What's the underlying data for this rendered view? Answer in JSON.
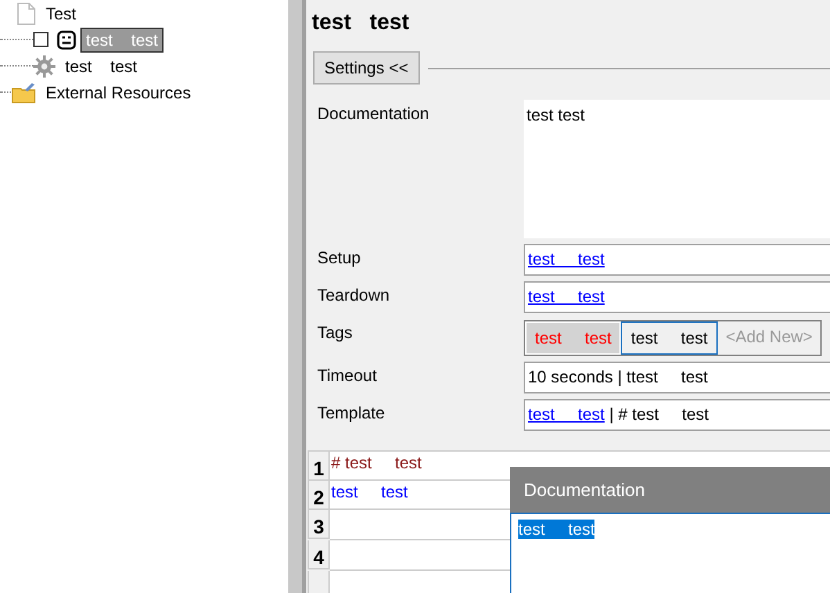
{
  "tree": [
    {
      "kind": "page",
      "label": "Test",
      "selected": false
    },
    {
      "kind": "robot",
      "label": "test    test",
      "selected": true,
      "checked": false
    },
    {
      "kind": "gear",
      "label": "test    test",
      "selected": false
    },
    {
      "kind": "folder",
      "label": "External Resources",
      "selected": false
    }
  ],
  "editor": {
    "title": "test   test",
    "settings_button": "Settings <<",
    "fields": [
      {
        "kind": "textarea",
        "label": "Documentation",
        "value": "test test"
      },
      {
        "kind": "link",
        "label": "Setup",
        "value": "test     test"
      },
      {
        "kind": "link",
        "label": "Teardown",
        "value": "test     test"
      },
      {
        "kind": "tags",
        "label": "Tags",
        "tags": [
          {
            "kind": "inherited",
            "label": "test     test"
          },
          {
            "kind": "own",
            "label": "test     test"
          },
          {
            "kind": "add",
            "label": "<Add New>"
          }
        ]
      },
      {
        "kind": "text",
        "label": "Timeout",
        "value": "10 seconds | ttest     test"
      },
      {
        "kind": "template",
        "label": "Template",
        "link": "test     test",
        "value": "| # test     test"
      }
    ]
  },
  "grid": {
    "rows": [
      {
        "number": "1",
        "kind": "comment",
        "text": "# test     test"
      },
      {
        "number": "2",
        "kind": "keyword",
        "text": "test     test"
      },
      {
        "number": "3"
      },
      {
        "number": "4"
      }
    ]
  },
  "popup": {
    "title": "Documentation",
    "value": "test     test",
    "text_selected": true
  }
}
